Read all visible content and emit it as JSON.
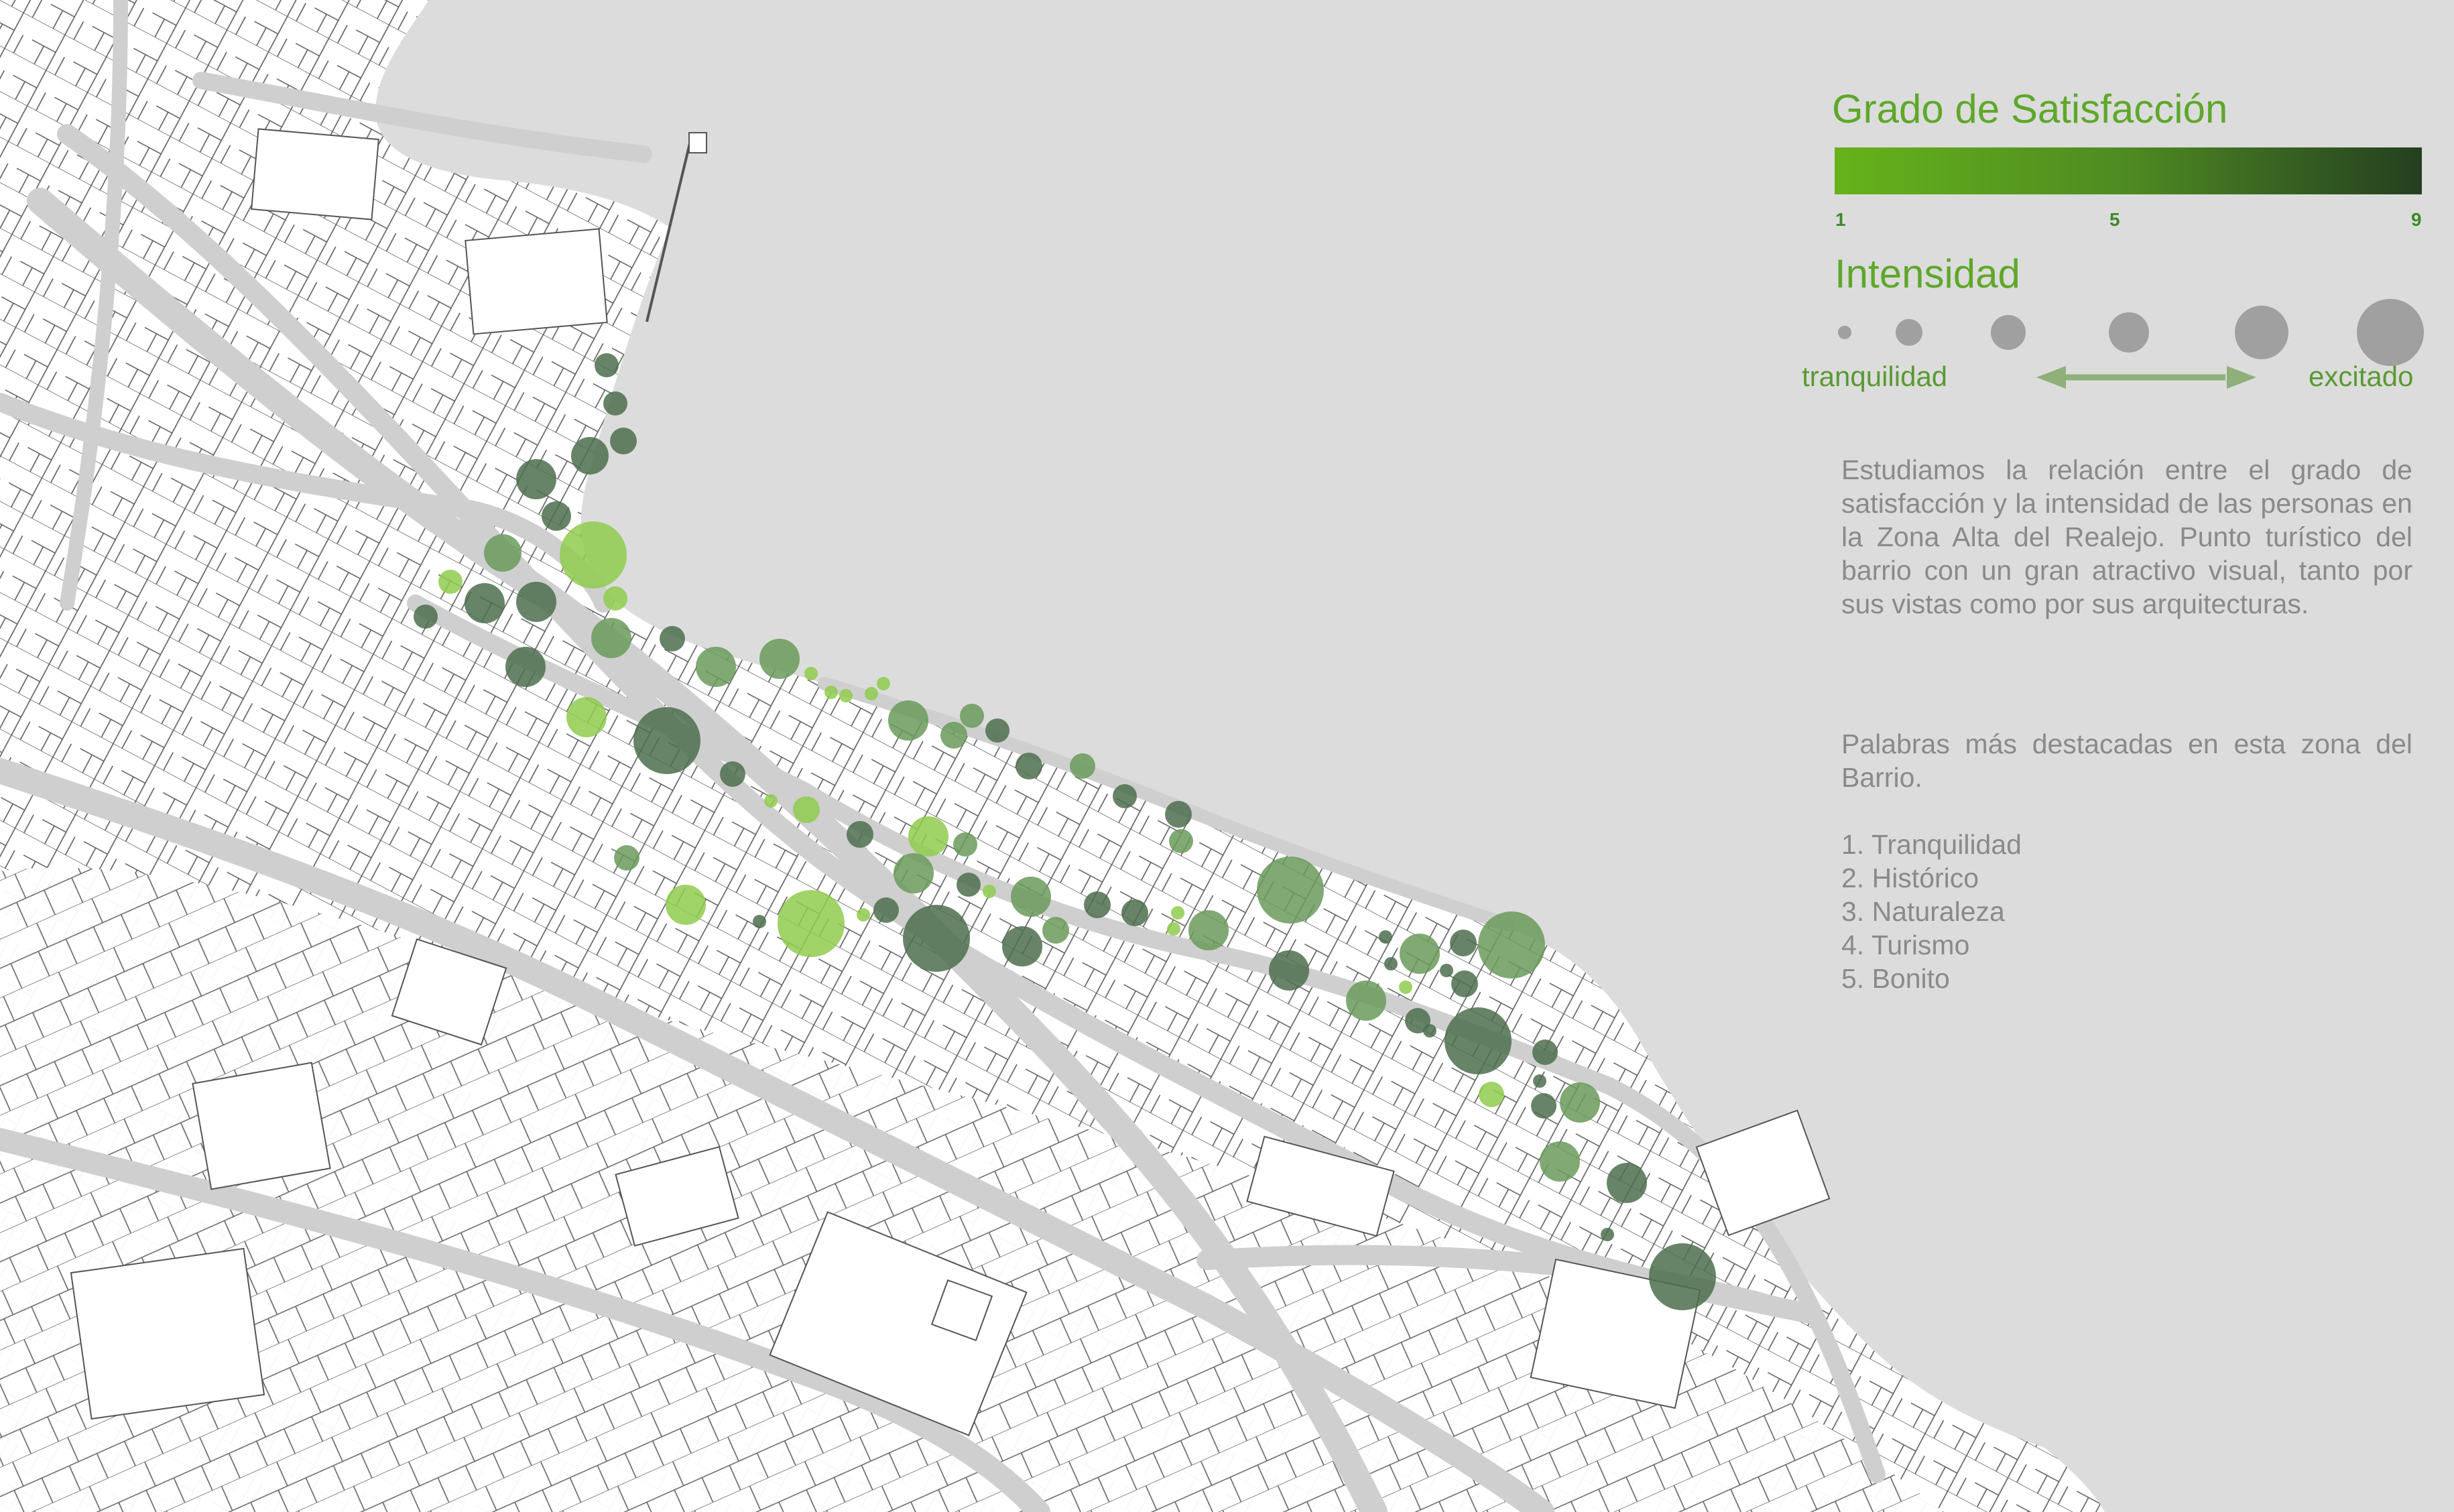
{
  "legend": {
    "satisfaction_title": "Grado de Satisfacción",
    "satisfaction_min": "1",
    "satisfaction_mid": "5",
    "satisfaction_max": "9",
    "gradient_start": "#66b31a",
    "gradient_end": "#243f20",
    "intensity_title": "Intensidad",
    "intensity_low": "tranquilidad",
    "intensity_high": "excitado",
    "circle_color": "#a0a0a0",
    "arrow_color": "#8fb07a"
  },
  "description": {
    "paragraph": "Estudiamos la relación entre el grado de satisfacción y la intensidad de las personas en la Zona Alta del Realejo. Punto turístico del barrio con un gran atractivo visual, tanto por sus vistas como por sus arquitecturas.",
    "keywords_intro": "Palabras más destacadas en esta zona del Barrio.",
    "keywords": [
      "1. Tranquilidad",
      "2. Histórico",
      "3. Naturaleza",
      "4. Turismo",
      "5. Bonito"
    ]
  },
  "map": {
    "background_color": "#dcdcdc",
    "land_color": "#ffffff",
    "street_color": "#cfcfcf",
    "line_color": "#555555"
  }
}
